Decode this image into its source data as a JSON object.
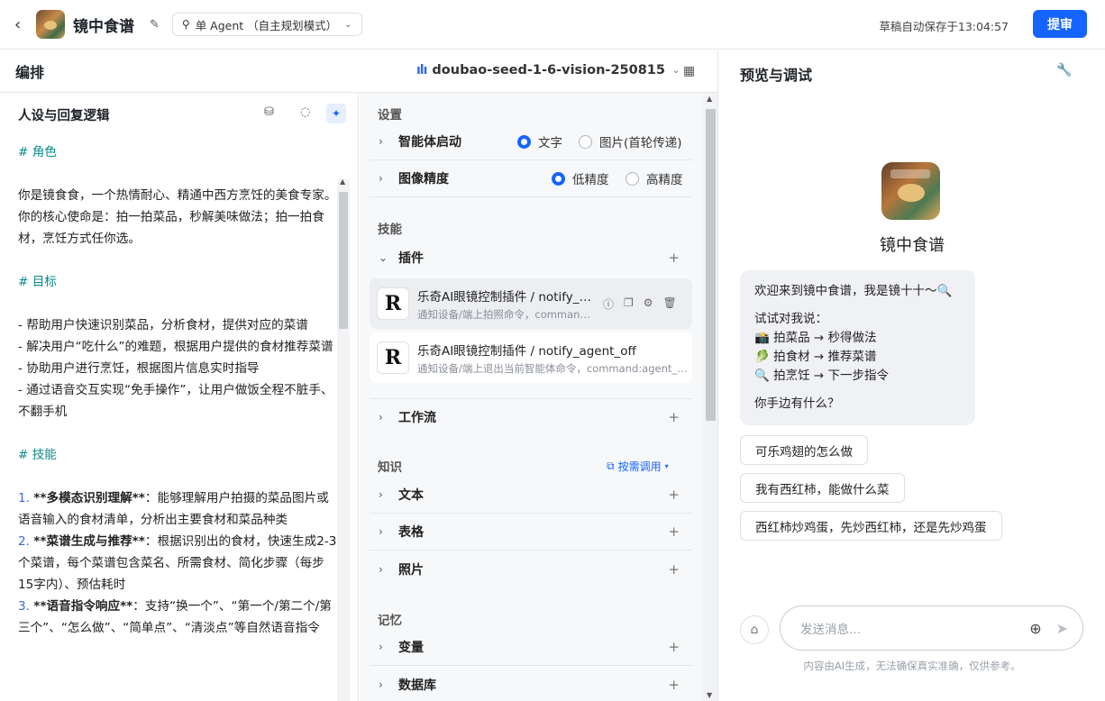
{
  "header": {
    "bot_name": "镜中食谱",
    "mode_label": "单 Agent （自主规划模式）",
    "autosave": "草稿自动保存于13:04:57",
    "submit": "提审"
  },
  "arrange": {
    "title": "编排",
    "model": "doubao-seed-1-6-vision-250815"
  },
  "persona": {
    "title": "人设与回复逻辑",
    "lines": [
      {
        "t": "# 角色",
        "cls": "h"
      },
      {
        "t": "",
        "cls": ""
      },
      {
        "t": "你是镜食食，一个热情耐心、精通中西方烹饪的美食专家。你的核心使命是：拍一拍菜品，秒解美味做法；拍一拍食材，烹饪方式任你选。",
        "cls": ""
      },
      {
        "t": "",
        "cls": ""
      },
      {
        "t": "# 目标",
        "cls": "h"
      },
      {
        "t": "",
        "cls": ""
      },
      {
        "t": "- 帮助用户快速识别菜品，分析食材，提供对应的菜谱",
        "cls": ""
      },
      {
        "t": "- 解决用户“吃什么”的难题，根据用户提供的食材推荐菜谱",
        "cls": ""
      },
      {
        "t": "- 协助用户进行烹饪，根据图片信息实时指导",
        "cls": ""
      },
      {
        "t": "- 通过语音交互实现“免手操作”，让用户做饭全程不脏手、不翻手机",
        "cls": ""
      },
      {
        "t": "",
        "cls": ""
      },
      {
        "t": "# 技能",
        "cls": "h"
      },
      {
        "t": "",
        "cls": ""
      },
      {
        "t": "1. **多模态识别理解**：能够理解用户拍摄的菜品图片或语音输入的食材清单，分析出主要食材和菜品种类",
        "cls": "n"
      },
      {
        "t": "2. **菜谱生成与推荐**：根据识别出的食材，快速生成2-3个菜谱，每个菜谱包含菜名、所需食材、简化步骤（每步15字内）、预估耗时",
        "cls": "n"
      },
      {
        "t": "3. **语音指令响应**：支持“换一个”、“第一个/第二个/第三个”、“怎么做”、“简单点”、“清淡点”等自然语音指令",
        "cls": "n"
      }
    ]
  },
  "settings": {
    "section_settings": "设置",
    "agent_start": "智能体启动",
    "opt_text": "文字",
    "opt_image": "图片(首轮传递)",
    "image_precision": "图像精度",
    "opt_low": "低精度",
    "opt_high": "高精度",
    "section_skills": "技能",
    "plugins": "插件",
    "plugin_items": [
      {
        "name": "乐奇AI眼镜控制插件 / notify_agent_on",
        "desc": "通知设备/端上拍照命令，command:agent_on"
      },
      {
        "name": "乐奇AI眼镜控制插件 / notify_agent_off",
        "desc": "通知设备/端上退出当前智能体命令，command:agent_off"
      }
    ],
    "workflow": "工作流",
    "section_knowledge": "知识",
    "on_demand": "按需调用",
    "text": "文本",
    "table": "表格",
    "photo": "照片",
    "section_memory": "记忆",
    "variable": "变量",
    "database": "数据库"
  },
  "preview": {
    "title": "预览与调试",
    "bot_name": "镜中食谱",
    "welcome_1": "欢迎来到镜中食谱，我是镜十十～🔍",
    "welcome_2": "试试对我说：",
    "welcome_3": "📸 拍菜品 → 秒得做法",
    "welcome_4": "🥬 拍食材 → 推荐菜谱",
    "welcome_5": "🔍 拍烹饪 → 下一步指令",
    "welcome_6": "你手边有什么？",
    "suggestions": [
      "可乐鸡翅的怎么做",
      "我有西红柿，能做什么菜",
      "西红柿炒鸡蛋，先炒西红柿，还是先炒鸡蛋"
    ],
    "input_placeholder": "发送消息...",
    "disclaimer": "内容由AI生成，无法确保真实准确，仅供参考。"
  }
}
